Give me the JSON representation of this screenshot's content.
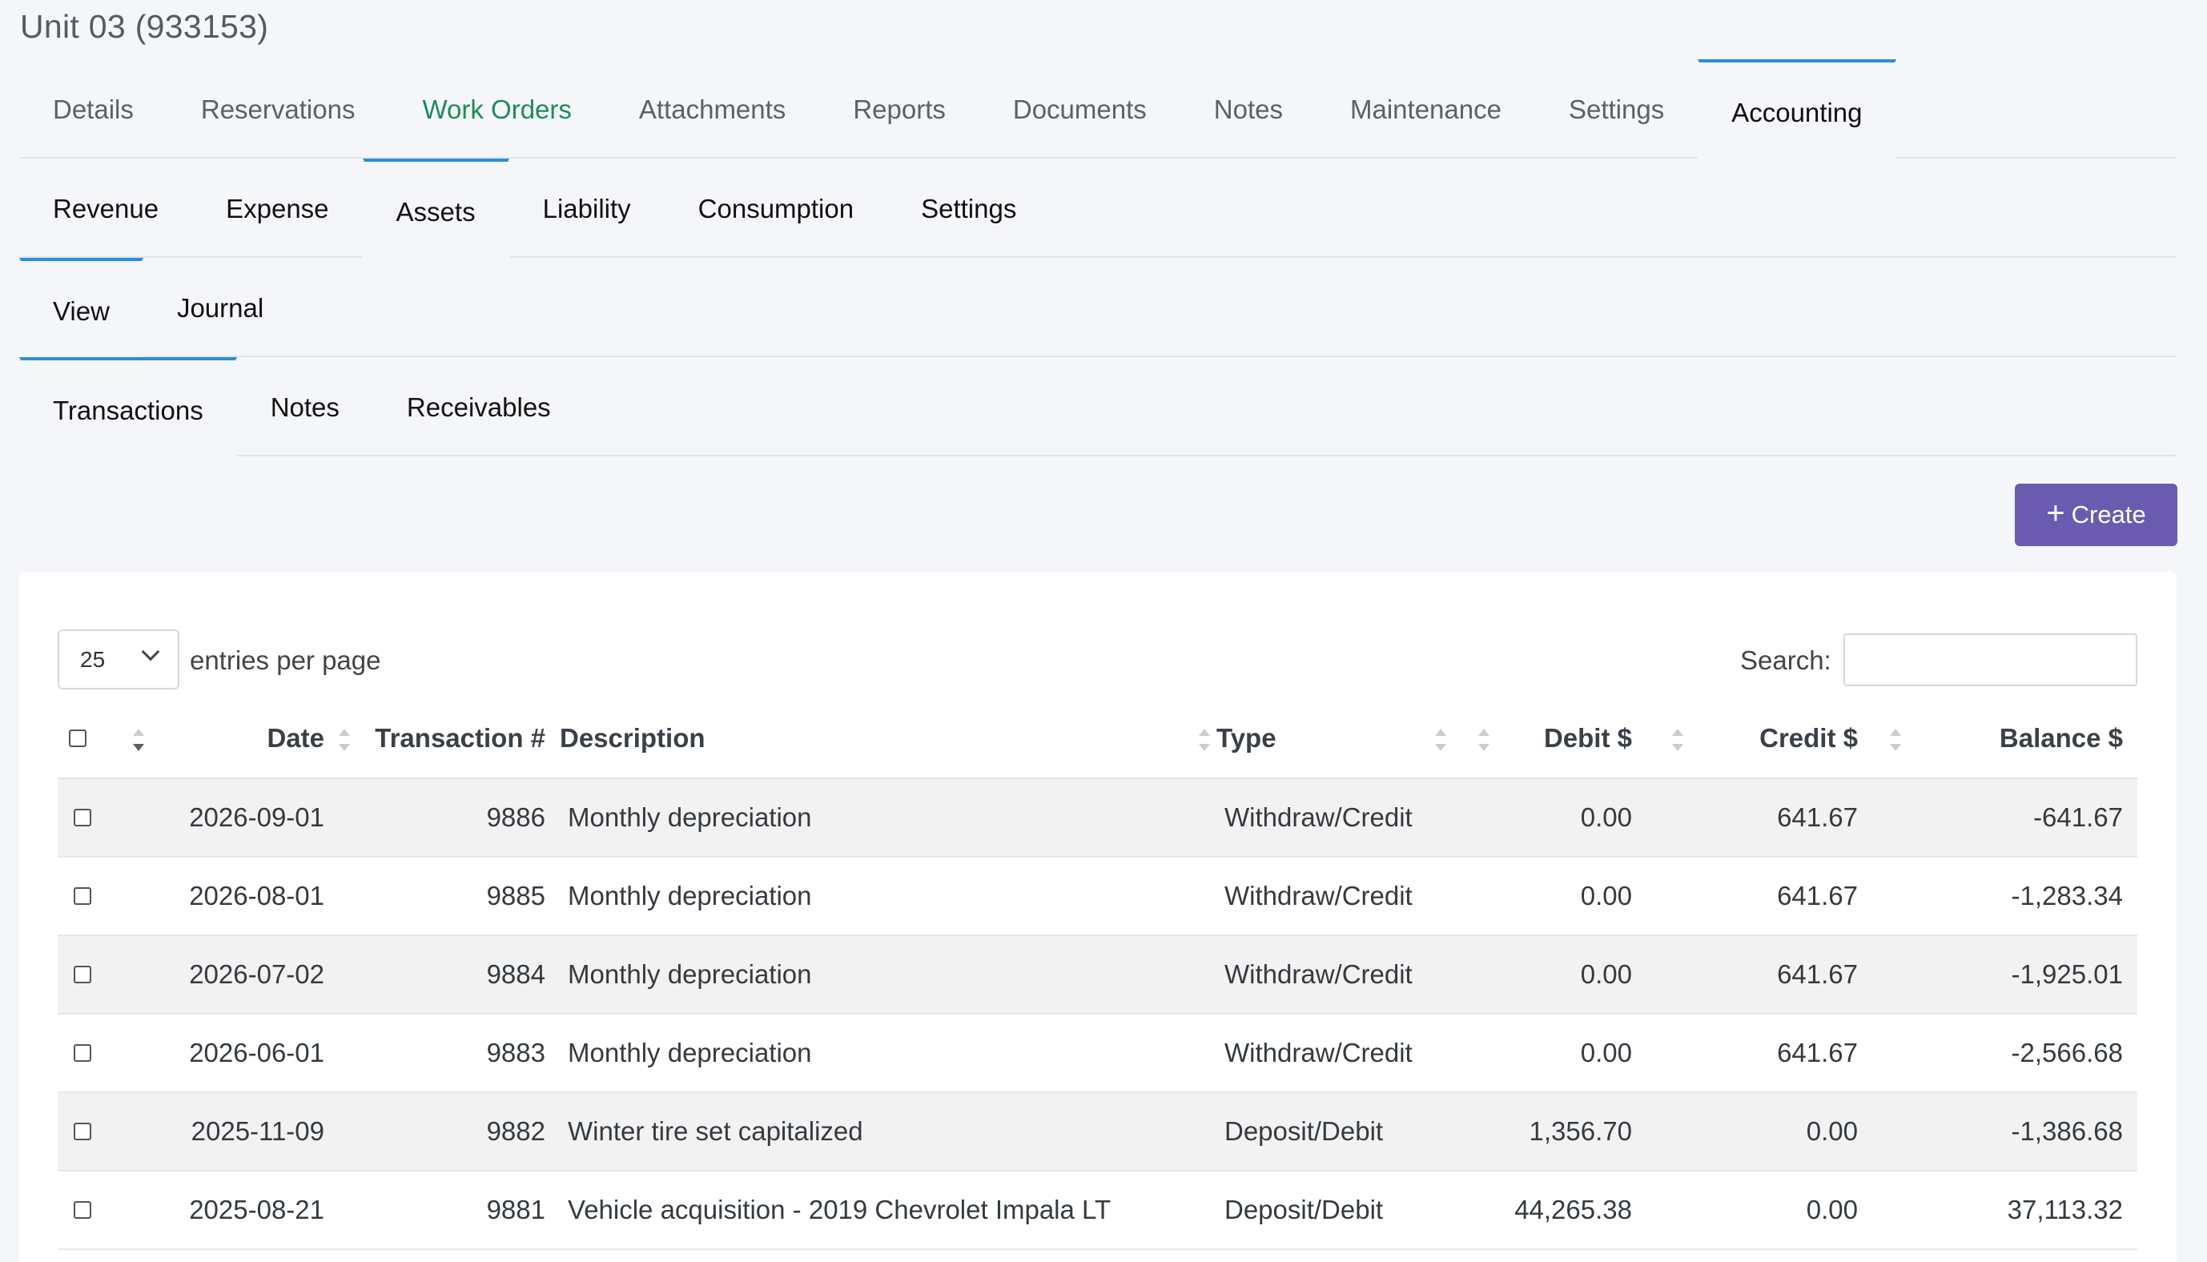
{
  "page": {
    "title": "Unit 03 (933153)"
  },
  "tabs_main": [
    {
      "label": "Details",
      "style": "muted"
    },
    {
      "label": "Reservations",
      "style": "muted"
    },
    {
      "label": "Work Orders",
      "style": "success"
    },
    {
      "label": "Attachments",
      "style": "muted"
    },
    {
      "label": "Reports",
      "style": "muted"
    },
    {
      "label": "Documents",
      "style": "muted"
    },
    {
      "label": "Notes",
      "style": "muted"
    },
    {
      "label": "Maintenance",
      "style": "muted"
    },
    {
      "label": "Settings",
      "style": "muted"
    },
    {
      "label": "Accounting",
      "style": "active"
    }
  ],
  "tabs_accounting": [
    {
      "label": "Revenue"
    },
    {
      "label": "Expense"
    },
    {
      "label": "Assets",
      "active": true
    },
    {
      "label": "Liability"
    },
    {
      "label": "Consumption"
    },
    {
      "label": "Settings"
    }
  ],
  "tabs_assets": [
    {
      "label": "View",
      "active": true
    },
    {
      "label": "Journal"
    }
  ],
  "tabs_view": [
    {
      "label": "Transactions",
      "active": true
    },
    {
      "label": "Notes"
    },
    {
      "label": "Receivables"
    }
  ],
  "toolbar": {
    "create_label": "Create"
  },
  "table_controls": {
    "entries_value": "25",
    "entries_label": "entries per page",
    "search_label": "Search:",
    "search_value": ""
  },
  "table": {
    "columns": [
      "Date",
      "Transaction #",
      "Description",
      "Type",
      "Debit $",
      "Credit $",
      "Balance $"
    ],
    "rows": [
      [
        "2026-09-01",
        "9886",
        "Monthly depreciation",
        "Withdraw/Credit",
        "0.00",
        "641.67",
        "-641.67"
      ],
      [
        "2026-08-01",
        "9885",
        "Monthly depreciation",
        "Withdraw/Credit",
        "0.00",
        "641.67",
        "-1,283.34"
      ],
      [
        "2026-07-02",
        "9884",
        "Monthly depreciation",
        "Withdraw/Credit",
        "0.00",
        "641.67",
        "-1,925.01"
      ],
      [
        "2026-06-01",
        "9883",
        "Monthly depreciation",
        "Withdraw/Credit",
        "0.00",
        "641.67",
        "-2,566.68"
      ],
      [
        "2025-11-09",
        "9882",
        "Winter tire set capitalized",
        "Deposit/Debit",
        "1,356.70",
        "0.00",
        "-1,386.68"
      ],
      [
        "2025-08-21",
        "9881",
        "Vehicle acquisition - 2019 Chevrolet Impala LT",
        "Deposit/Debit",
        "44,265.38",
        "0.00",
        "37,113.32"
      ]
    ]
  },
  "colors": {
    "accent_tab_border": "#2b8fd8",
    "create_button": "#6a5bb0",
    "work_orders_text": "#1f8a5c"
  }
}
